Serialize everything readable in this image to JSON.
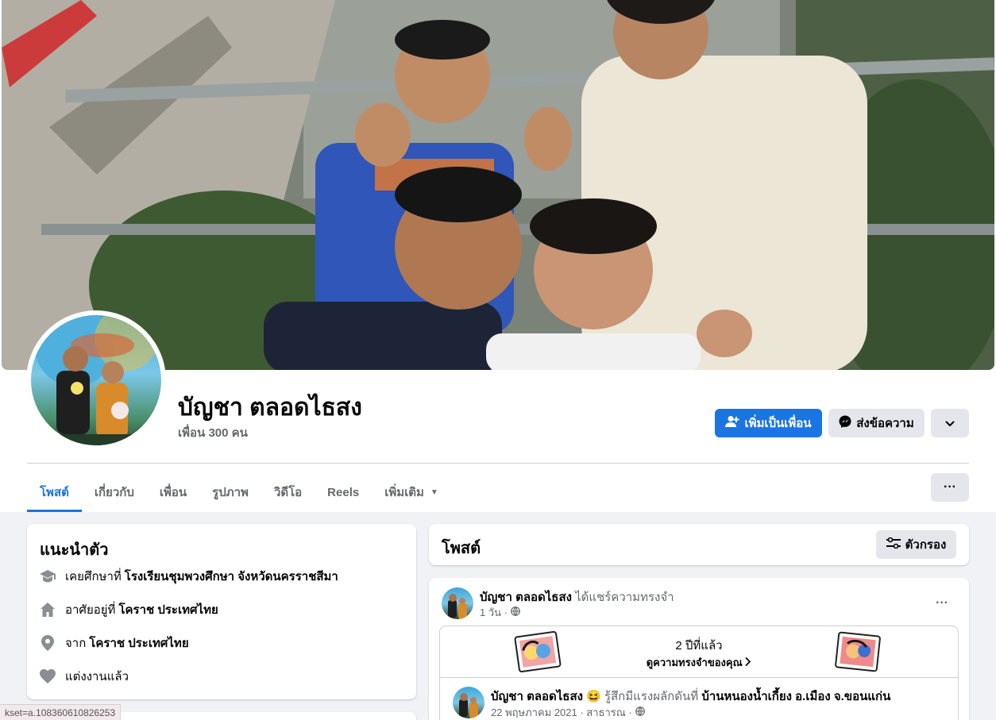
{
  "profile": {
    "name": "บัญชา ตลอดไธสง",
    "friends": "เพื่อน 300 คน"
  },
  "actions": {
    "add_friend": "เพิ่มเป็นเพื่อน",
    "message": "ส่งข้อความ"
  },
  "tabs": [
    {
      "label": "โพสต์",
      "active": true
    },
    {
      "label": "เกี่ยวกับ"
    },
    {
      "label": "เพื่อน"
    },
    {
      "label": "รูปภาพ"
    },
    {
      "label": "วิดีโอ"
    },
    {
      "label": "Reels"
    },
    {
      "label": "เพิ่มเติม"
    }
  ],
  "intro": {
    "title": "แนะนำตัว",
    "items": [
      {
        "icon": "graduation-cap-icon",
        "prefix": "เคยศึกษาที่",
        "value": "โรงเรียนชุมพวงศึกษา จังหวัดนครราชสีมา"
      },
      {
        "icon": "home-icon",
        "prefix": "อาศัยอยู่ที่",
        "value": "โคราช ประเทศไทย"
      },
      {
        "icon": "location-pin-icon",
        "prefix": "จาก",
        "value": "โคราช ประเทศไทย"
      },
      {
        "icon": "heart-icon",
        "prefix": "แต่งงานแล้ว",
        "value": ""
      }
    ]
  },
  "posts_header": {
    "title": "โพสต์",
    "filter_label": "ตัวกรอง"
  },
  "post": {
    "author": "บัญชา ตลอดไธสง",
    "action": "ได้แชร์ความทรงจำ",
    "time": "1 วัน ·",
    "memory_years": "2 ปีที่แล้ว",
    "memory_link": "ดูความทรงจำของคุณ",
    "shared": {
      "author": "บัญชา ตลอดไธสง",
      "emoji": "😆",
      "feeling": "รู้สึกมีแรงผลักดันที่",
      "place": "บ้านหนองน้ำเกี้ยง อ.เมือง จ.ขอนแก่น",
      "time": "22 พฤษภาคม 2021 · สาธารณ ·"
    }
  },
  "status_bar": {
    "url": "kset=a.108360610826253"
  },
  "colors": {
    "accent": "#1b74e4",
    "background": "#f0f2f5",
    "secondary_text": "#65676b"
  }
}
